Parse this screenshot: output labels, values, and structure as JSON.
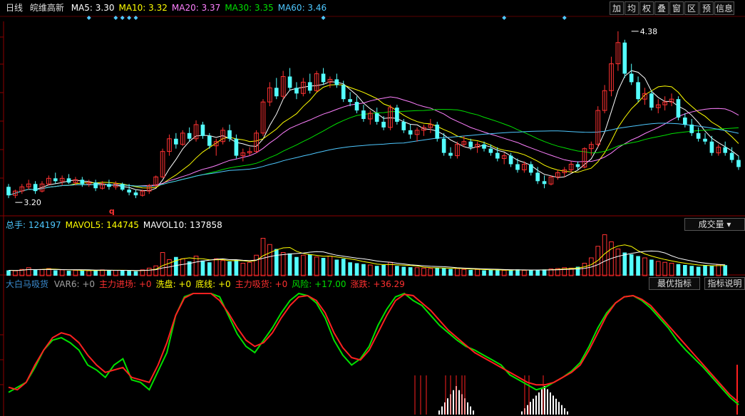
{
  "main_header": {
    "period": "日线",
    "stock_name": "皖维高新",
    "ma": [
      {
        "label": "MA5: ",
        "value": "3.30",
        "color": "#ffffff"
      },
      {
        "label": "MA10: ",
        "value": "3.32",
        "color": "#ffff00"
      },
      {
        "label": "MA20: ",
        "value": "3.37",
        "color": "#ff80ff"
      },
      {
        "label": "MA30: ",
        "value": "3.35",
        "color": "#00e000"
      },
      {
        "label": "MA60: ",
        "value": "3.46",
        "color": "#4ec8ff"
      }
    ]
  },
  "toolbar": [
    "加",
    "均",
    "权",
    "叠",
    "窗",
    "区",
    "预",
    "信息"
  ],
  "volume_header": {
    "items": [
      {
        "label": "总手: ",
        "value": "124197",
        "color": "#4ec8ff"
      },
      {
        "label": "MAVOL5: ",
        "value": "144745",
        "color": "#ffff00"
      },
      {
        "label": "MAVOL10: ",
        "value": "137858",
        "color": "#ffffff"
      }
    ],
    "button": "成交量"
  },
  "indicator_header": {
    "name": "大白马吸货",
    "items": [
      {
        "label": "VAR6: ",
        "value": "+0",
        "color": "#a0a0a0"
      },
      {
        "label": "主力进场: ",
        "value": "+0",
        "color": "#ff3030"
      },
      {
        "label": "洗盘: ",
        "value": "+0",
        "color": "#ffff00"
      },
      {
        "label": "底线: ",
        "value": "+0",
        "color": "#ffff00"
      },
      {
        "label": "主力吸货: ",
        "value": "+0",
        "color": "#ff3030"
      },
      {
        "label": "风险: ",
        "value": "+17.00",
        "color": "#00e000"
      },
      {
        "label": "涨跌: ",
        "value": "+36.29",
        "color": "#ff3030"
      }
    ],
    "buttons": [
      "最优指标",
      "指标说明"
    ]
  },
  "chart_data": [
    {
      "type": "candlestick",
      "title": "皖维高新 日线",
      "ylim": [
        3.1,
        4.45
      ],
      "annotations": [
        {
          "text": "4.38",
          "index": 93,
          "value": 4.38,
          "kind": "high"
        },
        {
          "text": "3.20",
          "index": 1,
          "value": 3.2,
          "kind": "low"
        },
        {
          "text": "q",
          "index": 15,
          "kind": "marker"
        }
      ],
      "signal_markers_index": [
        12,
        16,
        17,
        18,
        19,
        47,
        74,
        83
      ],
      "ohlc": [
        [
          3.28,
          3.3,
          3.2,
          3.22
        ],
        [
          3.22,
          3.26,
          3.2,
          3.25
        ],
        [
          3.25,
          3.3,
          3.23,
          3.28
        ],
        [
          3.28,
          3.33,
          3.26,
          3.3
        ],
        [
          3.3,
          3.32,
          3.23,
          3.25
        ],
        [
          3.25,
          3.32,
          3.24,
          3.3
        ],
        [
          3.3,
          3.36,
          3.29,
          3.34
        ],
        [
          3.34,
          3.38,
          3.3,
          3.32
        ],
        [
          3.32,
          3.36,
          3.29,
          3.34
        ],
        [
          3.34,
          3.37,
          3.3,
          3.31
        ],
        [
          3.31,
          3.35,
          3.29,
          3.33
        ],
        [
          3.33,
          3.35,
          3.28,
          3.3
        ],
        [
          3.3,
          3.33,
          3.28,
          3.31
        ],
        [
          3.31,
          3.33,
          3.25,
          3.27
        ],
        [
          3.27,
          3.32,
          3.26,
          3.3
        ],
        [
          3.3,
          3.33,
          3.26,
          3.28
        ],
        [
          3.28,
          3.32,
          3.26,
          3.3
        ],
        [
          3.3,
          3.31,
          3.25,
          3.26
        ],
        [
          3.26,
          3.3,
          3.22,
          3.24
        ],
        [
          3.24,
          3.26,
          3.2,
          3.22
        ],
        [
          3.22,
          3.26,
          3.21,
          3.25
        ],
        [
          3.25,
          3.3,
          3.23,
          3.29
        ],
        [
          3.29,
          3.36,
          3.28,
          3.35
        ],
        [
          3.35,
          3.55,
          3.34,
          3.53
        ],
        [
          3.53,
          3.65,
          3.5,
          3.62
        ],
        [
          3.62,
          3.66,
          3.55,
          3.58
        ],
        [
          3.58,
          3.68,
          3.57,
          3.66
        ],
        [
          3.66,
          3.7,
          3.6,
          3.62
        ],
        [
          3.62,
          3.75,
          3.6,
          3.72
        ],
        [
          3.72,
          3.74,
          3.62,
          3.64
        ],
        [
          3.64,
          3.66,
          3.55,
          3.57
        ],
        [
          3.57,
          3.62,
          3.5,
          3.6
        ],
        [
          3.6,
          3.7,
          3.58,
          3.68
        ],
        [
          3.68,
          3.72,
          3.6,
          3.62
        ],
        [
          3.62,
          3.65,
          3.48,
          3.5
        ],
        [
          3.5,
          3.55,
          3.46,
          3.52
        ],
        [
          3.52,
          3.56,
          3.5,
          3.53
        ],
        [
          3.53,
          3.68,
          3.52,
          3.66
        ],
        [
          3.66,
          3.9,
          3.64,
          3.88
        ],
        [
          3.88,
          4.02,
          3.85,
          3.98
        ],
        [
          3.98,
          4.05,
          3.9,
          3.92
        ],
        [
          3.92,
          4.1,
          3.9,
          4.06
        ],
        [
          4.06,
          4.12,
          3.96,
          3.98
        ],
        [
          3.98,
          4.02,
          3.9,
          3.94
        ],
        [
          3.94,
          4.05,
          3.92,
          4.02
        ],
        [
          4.02,
          4.08,
          3.94,
          3.96
        ],
        [
          3.96,
          4.1,
          3.95,
          4.08
        ],
        [
          4.08,
          4.12,
          4.0,
          4.02
        ],
        [
          4.02,
          4.06,
          3.98,
          4.04
        ],
        [
          4.04,
          4.08,
          3.98,
          4.0
        ],
        [
          4.0,
          4.03,
          3.88,
          3.9
        ],
        [
          3.9,
          3.95,
          3.85,
          3.88
        ],
        [
          3.88,
          3.92,
          3.8,
          3.82
        ],
        [
          3.82,
          3.86,
          3.74,
          3.76
        ],
        [
          3.76,
          3.82,
          3.72,
          3.8
        ],
        [
          3.8,
          3.84,
          3.72,
          3.74
        ],
        [
          3.74,
          3.78,
          3.68,
          3.7
        ],
        [
          3.7,
          3.86,
          3.68,
          3.84
        ],
        [
          3.84,
          3.86,
          3.72,
          3.74
        ],
        [
          3.74,
          3.76,
          3.66,
          3.68
        ],
        [
          3.68,
          3.72,
          3.62,
          3.65
        ],
        [
          3.65,
          3.7,
          3.6,
          3.68
        ],
        [
          3.68,
          3.72,
          3.64,
          3.7
        ],
        [
          3.7,
          3.76,
          3.66,
          3.72
        ],
        [
          3.72,
          3.74,
          3.6,
          3.62
        ],
        [
          3.62,
          3.66,
          3.5,
          3.52
        ],
        [
          3.52,
          3.56,
          3.48,
          3.5
        ],
        [
          3.5,
          3.6,
          3.48,
          3.58
        ],
        [
          3.58,
          3.64,
          3.56,
          3.6
        ],
        [
          3.6,
          3.62,
          3.54,
          3.56
        ],
        [
          3.56,
          3.6,
          3.52,
          3.58
        ],
        [
          3.58,
          3.6,
          3.53,
          3.55
        ],
        [
          3.55,
          3.58,
          3.5,
          3.52
        ],
        [
          3.52,
          3.56,
          3.46,
          3.48
        ],
        [
          3.48,
          3.52,
          3.44,
          3.5
        ],
        [
          3.5,
          3.52,
          3.42,
          3.44
        ],
        [
          3.44,
          3.48,
          3.38,
          3.4
        ],
        [
          3.4,
          3.46,
          3.38,
          3.44
        ],
        [
          3.44,
          3.46,
          3.36,
          3.38
        ],
        [
          3.38,
          3.42,
          3.3,
          3.32
        ],
        [
          3.32,
          3.36,
          3.27,
          3.3
        ],
        [
          3.3,
          3.36,
          3.29,
          3.35
        ],
        [
          3.35,
          3.4,
          3.33,
          3.38
        ],
        [
          3.38,
          3.42,
          3.35,
          3.4
        ],
        [
          3.4,
          3.46,
          3.38,
          3.44
        ],
        [
          3.44,
          3.46,
          3.4,
          3.42
        ],
        [
          3.42,
          3.56,
          3.41,
          3.55
        ],
        [
          3.55,
          3.6,
          3.5,
          3.58
        ],
        [
          3.58,
          3.85,
          3.56,
          3.82
        ],
        [
          3.82,
          4.0,
          3.8,
          3.96
        ],
        [
          3.96,
          4.2,
          3.92,
          4.15
        ],
        [
          4.15,
          4.38,
          4.1,
          4.3
        ],
        [
          4.3,
          4.32,
          4.05,
          4.08
        ],
        [
          4.08,
          4.15,
          4.0,
          4.02
        ],
        [
          4.02,
          4.06,
          3.88,
          3.9
        ],
        [
          3.9,
          3.98,
          3.86,
          3.94
        ],
        [
          3.94,
          3.96,
          3.82,
          3.84
        ],
        [
          3.84,
          3.9,
          3.8,
          3.86
        ],
        [
          3.86,
          3.92,
          3.82,
          3.88
        ],
        [
          3.88,
          3.94,
          3.85,
          3.9
        ],
        [
          3.9,
          3.92,
          3.75,
          3.77
        ],
        [
          3.77,
          3.8,
          3.7,
          3.72
        ],
        [
          3.72,
          3.76,
          3.64,
          3.66
        ],
        [
          3.66,
          3.7,
          3.6,
          3.62
        ],
        [
          3.62,
          3.66,
          3.58,
          3.6
        ],
        [
          3.6,
          3.64,
          3.5,
          3.52
        ],
        [
          3.52,
          3.58,
          3.5,
          3.56
        ],
        [
          3.56,
          3.6,
          3.5,
          3.52
        ],
        [
          3.52,
          3.56,
          3.45,
          3.47
        ],
        [
          3.47,
          3.5,
          3.4,
          3.42
        ]
      ],
      "volume_ylim": [
        0,
        520000
      ],
      "volume": [
        60000,
        55000,
        70000,
        90000,
        65000,
        70000,
        80000,
        60000,
        65000,
        55000,
        60000,
        58000,
        55000,
        60000,
        65000,
        62000,
        60000,
        58000,
        55000,
        50000,
        65000,
        85000,
        110000,
        260000,
        180000,
        210000,
        190000,
        160000,
        220000,
        170000,
        150000,
        190000,
        170000,
        160000,
        180000,
        140000,
        150000,
        230000,
        420000,
        350000,
        300000,
        260000,
        250000,
        210000,
        230000,
        240000,
        210000,
        200000,
        220000,
        180000,
        190000,
        150000,
        140000,
        130000,
        120000,
        110000,
        120000,
        150000,
        110000,
        100000,
        95000,
        90000,
        85000,
        80000,
        90000,
        85000,
        75000,
        80000,
        70000,
        65000,
        70000,
        60000,
        65000,
        62000,
        60000,
        65000,
        70000,
        60000,
        60000,
        65000,
        70000,
        75000,
        80000,
        90000,
        85000,
        100000,
        140000,
        200000,
        330000,
        460000,
        380000,
        300000,
        260000,
        240000,
        220000,
        200000,
        180000,
        160000,
        150000,
        140000,
        130000,
        120000,
        110000,
        100000,
        120000,
        110000,
        124197,
        118000
      ]
    },
    {
      "type": "line",
      "title": "大白马吸货",
      "ylim": [
        0,
        100
      ],
      "series": [
        {
          "name": "风险",
          "color": "#00e000",
          "values": [
            18,
            22,
            26,
            38,
            52,
            60,
            62,
            58,
            52,
            40,
            36,
            30,
            40,
            45,
            28,
            26,
            20,
            35,
            50,
            80,
            95,
            105,
            108,
            104,
            95,
            80,
            65,
            55,
            50,
            60,
            70,
            82,
            92,
            98,
            96,
            90,
            78,
            60,
            48,
            40,
            45,
            55,
            72,
            85,
            95,
            98,
            92,
            88,
            80,
            72,
            66,
            60,
            55,
            52,
            48,
            44,
            40,
            32,
            28,
            24,
            20,
            22,
            26,
            30,
            35,
            42,
            55,
            70,
            82,
            90,
            95,
            96,
            92,
            86,
            78,
            70,
            60,
            52,
            45,
            38,
            30,
            22,
            14,
            8
          ]
        },
        {
          "name": "涨跌",
          "color": "#ff2020",
          "values": [
            22,
            20,
            26,
            40,
            52,
            62,
            66,
            64,
            58,
            48,
            40,
            34,
            36,
            38,
            30,
            28,
            26,
            40,
            58,
            80,
            94,
            102,
            104,
            100,
            92,
            82,
            70,
            60,
            55,
            58,
            66,
            78,
            88,
            95,
            96,
            92,
            82,
            66,
            54,
            46,
            44,
            52,
            66,
            80,
            92,
            97,
            96,
            90,
            84,
            76,
            68,
            62,
            56,
            50,
            46,
            42,
            38,
            34,
            30,
            26,
            24,
            24,
            26,
            30,
            34,
            40,
            52,
            66,
            80,
            90,
            95,
            96,
            93,
            88,
            80,
            72,
            64,
            56,
            48,
            40,
            32,
            24,
            16,
            10
          ]
        }
      ],
      "bars_white": [
        0,
        0,
        0,
        0,
        0,
        0,
        0,
        0,
        0,
        0,
        0,
        0,
        0,
        0,
        0,
        0,
        0,
        0,
        0,
        0,
        0,
        0,
        0,
        0,
        0,
        0,
        0,
        0,
        0,
        0,
        0,
        0,
        0,
        0,
        0,
        0,
        0,
        0,
        0,
        0,
        0,
        0,
        0,
        0,
        0,
        0,
        0,
        0,
        0,
        0,
        0,
        0,
        0,
        0,
        0,
        0,
        0,
        0,
        0,
        0,
        0,
        0,
        0,
        0,
        0,
        0,
        0,
        0,
        0,
        0,
        0,
        0,
        0,
        0,
        0,
        0,
        0,
        0,
        0,
        0,
        0,
        0,
        0,
        0,
        0,
        0,
        0,
        0,
        0,
        0,
        0,
        0,
        0,
        0,
        0,
        0,
        0,
        0,
        0,
        0,
        0,
        0,
        0,
        0,
        0,
        0,
        0,
        0
      ]
    }
  ]
}
